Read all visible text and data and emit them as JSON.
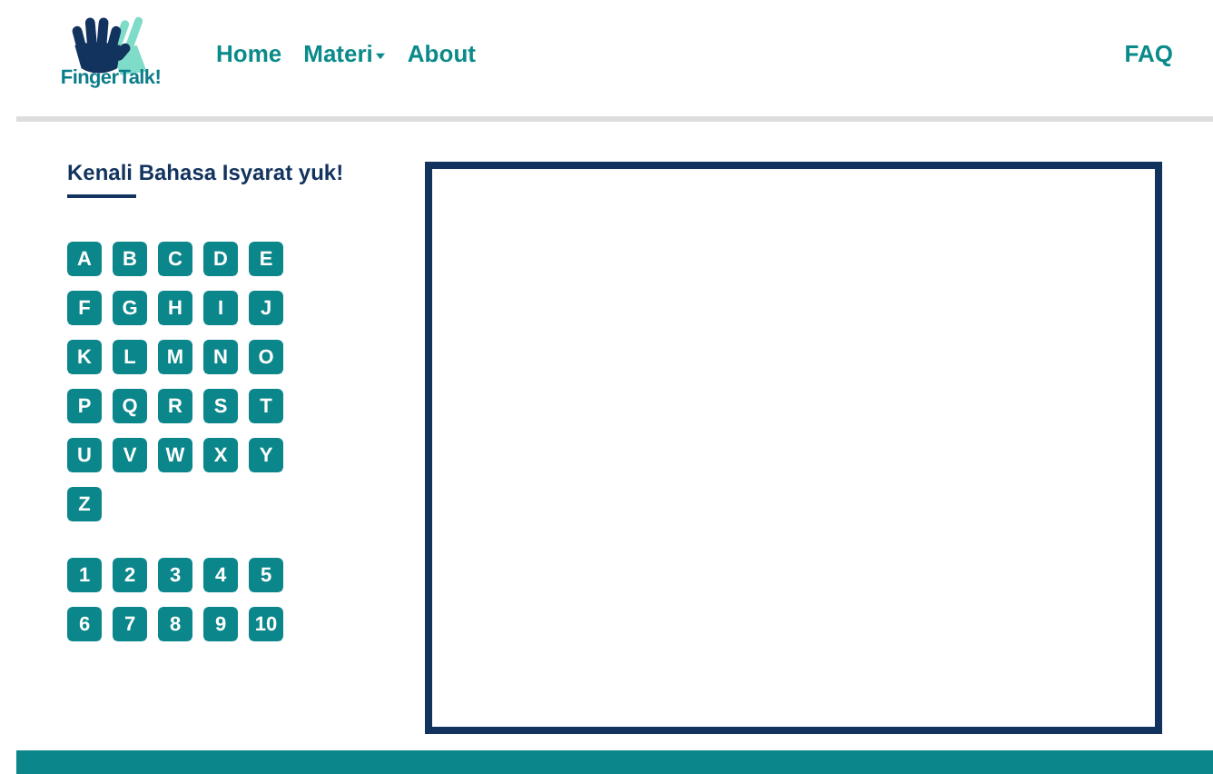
{
  "logo": {
    "text": "FingerTalk!"
  },
  "nav": [
    {
      "label": "Home",
      "has_menu": false
    },
    {
      "label": "Materi",
      "has_menu": true
    },
    {
      "label": "About",
      "has_menu": false
    }
  ],
  "nav_right": {
    "label": "FAQ"
  },
  "sidebar": {
    "title": "Kenali Bahasa Isyarat yuk!",
    "letters": [
      "A",
      "B",
      "C",
      "D",
      "E",
      "F",
      "G",
      "H",
      "I",
      "J",
      "K",
      "L",
      "M",
      "N",
      "O",
      "P",
      "Q",
      "R",
      "S",
      "T",
      "U",
      "V",
      "W",
      "X",
      "Y",
      "Z"
    ],
    "numbers": [
      "1",
      "2",
      "3",
      "4",
      "5",
      "6",
      "7",
      "8",
      "9",
      "10"
    ]
  }
}
